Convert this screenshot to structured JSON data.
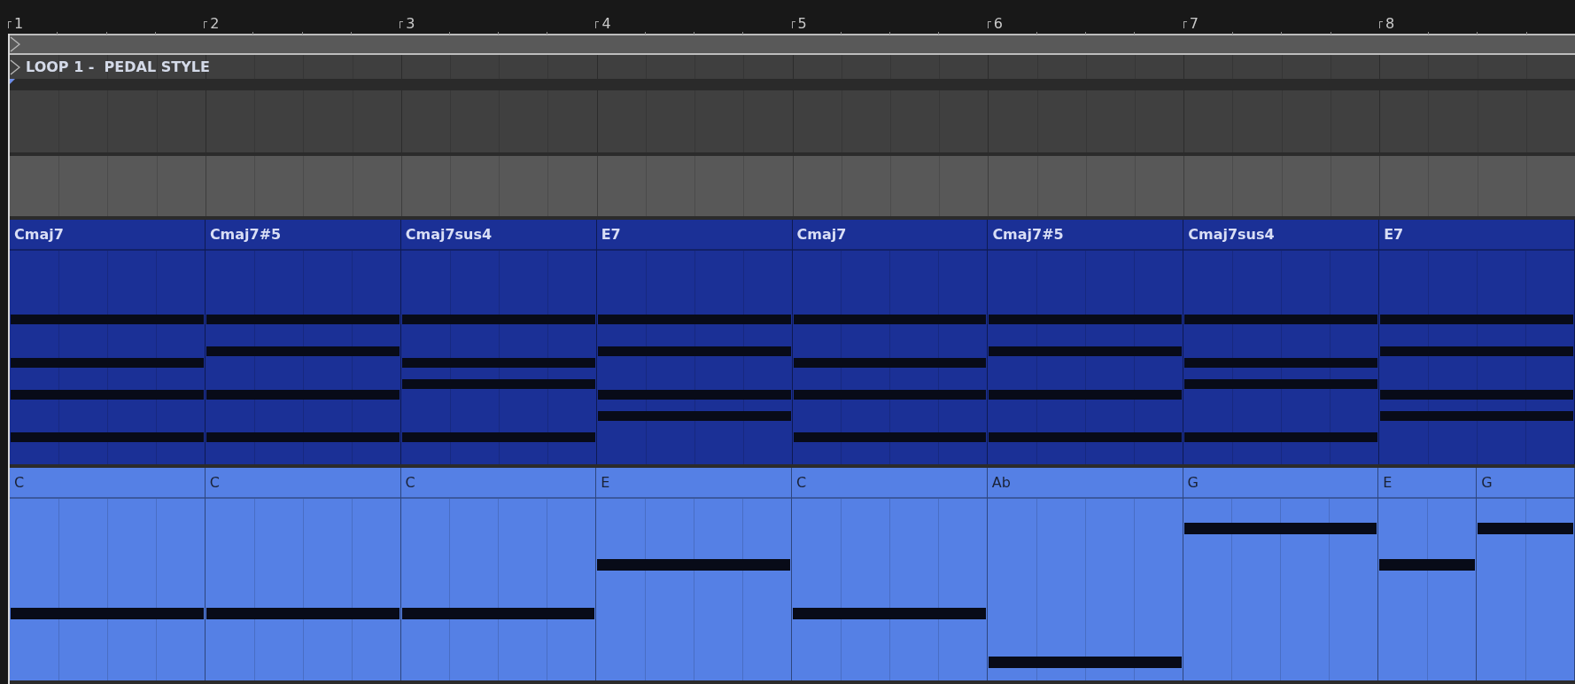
{
  "ruler": {
    "bars": [
      "1",
      "2",
      "3",
      "4",
      "5",
      "6",
      "7",
      "8"
    ]
  },
  "locator": {
    "label": "LOOP 1 -  PEDAL STYLE"
  },
  "tracks": [
    {
      "kind": "empty"
    },
    {
      "kind": "empty"
    },
    {
      "kind": "chords",
      "clips": [
        {
          "name": "Cmaj7",
          "kind": "bar",
          "notes": [
            {
              "kind": "c3"
            },
            {
              "kind": "e3"
            },
            {
              "kind": "g3"
            },
            {
              "kind": "b3"
            }
          ]
        },
        {
          "name": "Cmaj7#5",
          "kind": "bar",
          "notes": [
            {
              "kind": "c3"
            },
            {
              "kind": "e3"
            },
            {
              "kind": "gsharp3"
            },
            {
              "kind": "b3"
            }
          ]
        },
        {
          "name": "Cmaj7sus4",
          "kind": "bar",
          "notes": [
            {
              "kind": "c3"
            },
            {
              "kind": "f3"
            },
            {
              "kind": "g3"
            },
            {
              "kind": "b3"
            }
          ]
        },
        {
          "name": "E7",
          "kind": "bar",
          "notes": [
            {
              "kind": "d3"
            },
            {
              "kind": "e3"
            },
            {
              "kind": "gsharp3"
            },
            {
              "kind": "b3"
            }
          ]
        },
        {
          "name": "Cmaj7",
          "kind": "bar",
          "notes": [
            {
              "kind": "c3"
            },
            {
              "kind": "e3"
            },
            {
              "kind": "g3"
            },
            {
              "kind": "b3"
            }
          ]
        },
        {
          "name": "Cmaj7#5",
          "kind": "bar",
          "notes": [
            {
              "kind": "c3"
            },
            {
              "kind": "e3"
            },
            {
              "kind": "gsharp3"
            },
            {
              "kind": "b3"
            }
          ]
        },
        {
          "name": "Cmaj7sus4",
          "kind": "bar",
          "notes": [
            {
              "kind": "c3"
            },
            {
              "kind": "f3"
            },
            {
              "kind": "g3"
            },
            {
              "kind": "b3"
            }
          ]
        },
        {
          "name": "E7",
          "kind": "bar",
          "notes": [
            {
              "kind": "d3"
            },
            {
              "kind": "e3"
            },
            {
              "kind": "gsharp3"
            },
            {
              "kind": "b3"
            }
          ]
        }
      ]
    },
    {
      "kind": "bass",
      "clips": [
        {
          "name": "C",
          "kind": "bar",
          "notes": [
            {
              "kind": "c2"
            }
          ]
        },
        {
          "name": "C",
          "kind": "bar",
          "notes": [
            {
              "kind": "c2"
            }
          ]
        },
        {
          "name": "C",
          "kind": "bar",
          "notes": [
            {
              "kind": "c2"
            }
          ]
        },
        {
          "name": "E",
          "kind": "bar",
          "notes": [
            {
              "kind": "e2"
            }
          ]
        },
        {
          "name": "C",
          "kind": "bar",
          "notes": [
            {
              "kind": "c2"
            }
          ]
        },
        {
          "name": "Ab",
          "kind": "bar",
          "notes": [
            {
              "kind": "gsharp1"
            }
          ]
        },
        {
          "name": "G",
          "kind": "bar",
          "notes": [
            {
              "kind": "g2"
            }
          ]
        },
        {
          "name": "E",
          "kind": "half",
          "notes": [
            {
              "kind": "e2"
            }
          ]
        },
        {
          "name": "G",
          "kind": "half",
          "notes": [
            {
              "kind": "g2"
            }
          ]
        }
      ]
    }
  ]
}
